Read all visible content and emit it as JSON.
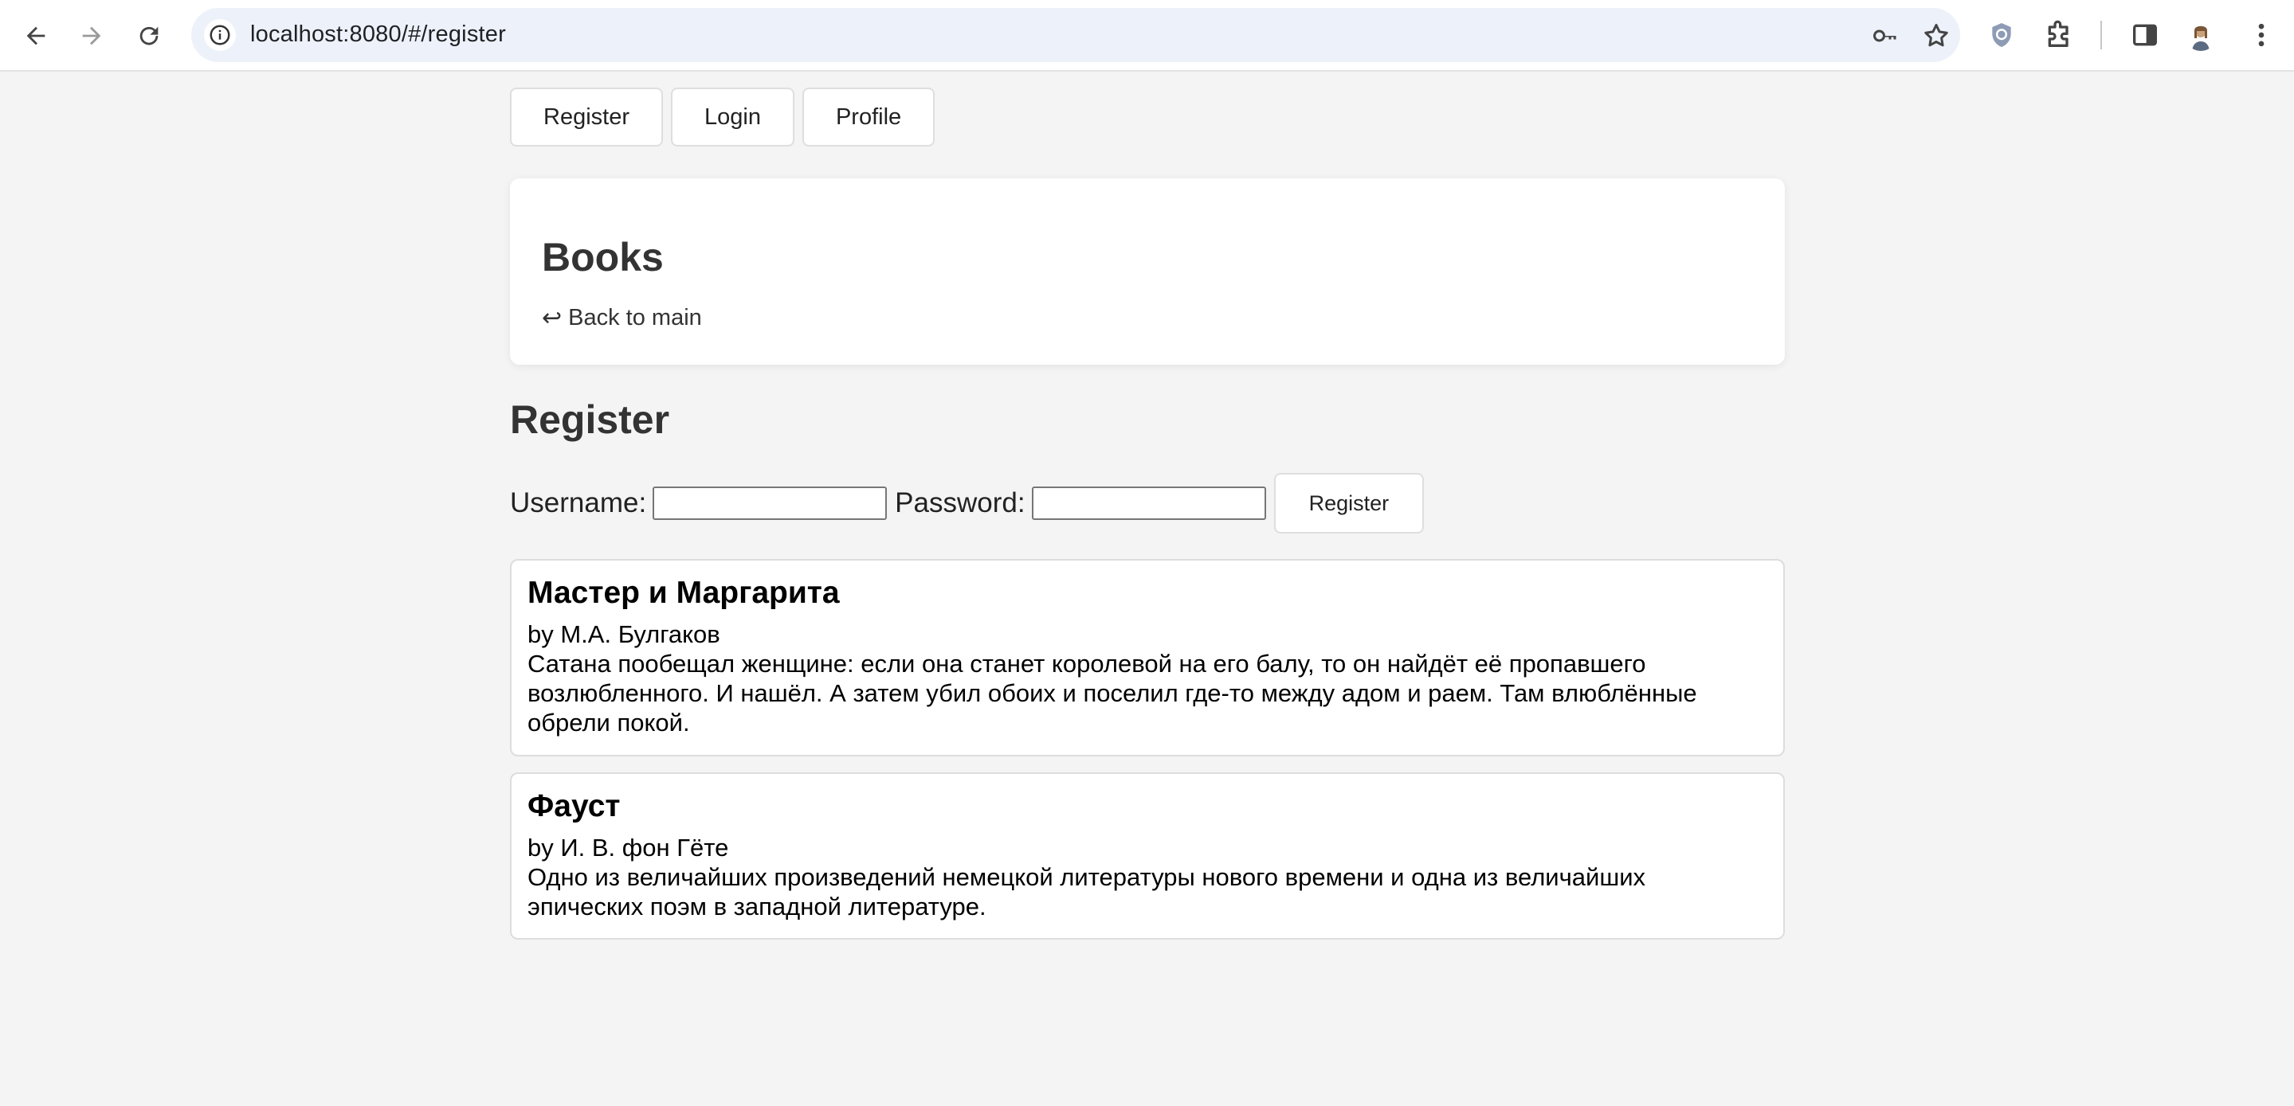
{
  "browser": {
    "url": "localhost:8080/#/register"
  },
  "nav": {
    "register": "Register",
    "login": "Login",
    "profile": "Profile"
  },
  "header": {
    "title": "Books",
    "back_icon": "return-arrow-icon",
    "back_label": "Back to main"
  },
  "register_form": {
    "title": "Register",
    "username_label": "Username:",
    "username_value": "",
    "password_label": "Password:",
    "password_value": "",
    "submit_label": "Register"
  },
  "books": [
    {
      "title": "Мастер и Маргарита",
      "author": "by М.А. Булгаков",
      "description": "Сатана пообещал женщине: если она станет королевой на его балу, то он найдёт её пропавшего возлюбленного. И нашёл. А затем убил обоих и поселил где-то между адом и раем. Там влюблённые обрели покой."
    },
    {
      "title": "Фауст",
      "author": "by И. В. фон Гёте",
      "description": "Одно из величайших произведений немецкой литературы нового времени и одна из величайших эпических поэм в западной литературе."
    }
  ]
}
